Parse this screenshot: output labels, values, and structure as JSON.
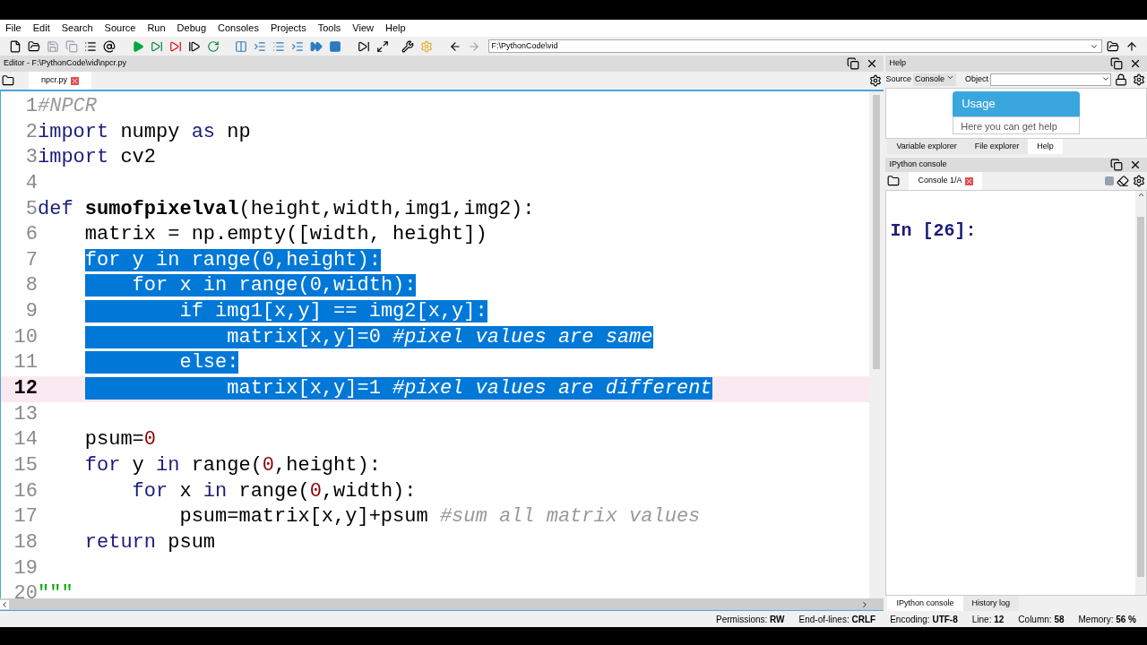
{
  "menu": [
    "File",
    "Edit",
    "Search",
    "Source",
    "Run",
    "Debug",
    "Consoles",
    "Projects",
    "Tools",
    "View",
    "Help"
  ],
  "path_field": {
    "value": "F:\\PythonCode\\vid"
  },
  "editor": {
    "title": "Editor - F:\\PythonCode\\vid\\npcr.py",
    "tabs": [
      {
        "label": "npcr.py",
        "selected": true
      }
    ],
    "lines": [
      {
        "number": "1",
        "selected": false,
        "current": false,
        "tokens": [
          {
            "kind": "comment",
            "text": "#NPCR"
          }
        ]
      },
      {
        "number": "2",
        "selected": false,
        "current": false,
        "tokens": [
          {
            "kind": "keyword",
            "text": "import"
          },
          {
            "kind": "plain",
            "text": " numpy "
          },
          {
            "kind": "keyword",
            "text": "as"
          },
          {
            "kind": "plain",
            "text": " np"
          }
        ]
      },
      {
        "number": "3",
        "selected": false,
        "current": false,
        "tokens": [
          {
            "kind": "keyword",
            "text": "import"
          },
          {
            "kind": "plain",
            "text": " cv2"
          }
        ]
      },
      {
        "number": "4",
        "selected": false,
        "current": false
      },
      {
        "number": "5",
        "selected": false,
        "current": false,
        "tokens": [
          {
            "kind": "keyword",
            "text": "def"
          },
          {
            "kind": "defname",
            "text": " sumofpixelval"
          },
          {
            "kind": "plain",
            "text": "(height,width,img1,img2):"
          }
        ]
      },
      {
        "number": "6",
        "selected": false,
        "current": false,
        "tokens": [
          {
            "kind": "plain",
            "text": "    matrix = np.empty([width, height])"
          }
        ]
      },
      {
        "number": "7",
        "selected": true,
        "current": false,
        "tokens": [
          {
            "kind": "keyword",
            "text": "    for"
          },
          {
            "kind": "plain",
            "text": " y "
          },
          {
            "kind": "keyword",
            "text": "in"
          },
          {
            "kind": "plain",
            "text": " range(0,height):"
          }
        ]
      },
      {
        "number": "8",
        "selected": true,
        "current": false,
        "tokens": [
          {
            "kind": "keyword",
            "text": "        for"
          },
          {
            "kind": "plain",
            "text": " x "
          },
          {
            "kind": "keyword",
            "text": "in"
          },
          {
            "kind": "plain",
            "text": " range(0,width):"
          }
        ]
      },
      {
        "number": "9",
        "selected": true,
        "current": false,
        "tokens": [
          {
            "kind": "keyword",
            "text": "            if"
          },
          {
            "kind": "plain",
            "text": " img1[x,y] == img2[x,y]:"
          }
        ]
      },
      {
        "number": "10",
        "selected": true,
        "current": false,
        "tokens": [
          {
            "kind": "plain",
            "text": "                matrix[x,y]=0 "
          },
          {
            "kind": "comment",
            "text": "#pixel values are same"
          }
        ]
      },
      {
        "number": "11",
        "selected": true,
        "current": false,
        "tokens": [
          {
            "kind": "keyword",
            "text": "            else"
          },
          {
            "kind": "plain",
            "text": ":"
          }
        ]
      },
      {
        "number": "12",
        "selected": true,
        "current": true,
        "tokens": [
          {
            "kind": "plain",
            "text": "                matrix[x,y]=1 "
          },
          {
            "kind": "comment",
            "text": "#pixel values are different"
          }
        ]
      },
      {
        "number": "13",
        "selected": false,
        "current": false
      },
      {
        "number": "14",
        "selected": false,
        "current": false,
        "tokens": [
          {
            "kind": "plain",
            "text": "    psum="
          },
          {
            "kind": "number",
            "text": "0"
          }
        ]
      },
      {
        "number": "15",
        "selected": false,
        "current": false,
        "tokens": [
          {
            "kind": "keyword",
            "text": "    for"
          },
          {
            "kind": "plain",
            "text": " y "
          },
          {
            "kind": "keyword",
            "text": "in"
          },
          {
            "kind": "plain",
            "text": " range("
          },
          {
            "kind": "number",
            "text": "0"
          },
          {
            "kind": "plain",
            "text": ",height):"
          }
        ]
      },
      {
        "number": "16",
        "selected": false,
        "current": false,
        "tokens": [
          {
            "kind": "keyword",
            "text": "        for"
          },
          {
            "kind": "plain",
            "text": " x "
          },
          {
            "kind": "keyword",
            "text": "in"
          },
          {
            "kind": "plain",
            "text": " range("
          },
          {
            "kind": "number",
            "text": "0"
          },
          {
            "kind": "plain",
            "text": ",width):"
          }
        ]
      },
      {
        "number": "17",
        "selected": false,
        "current": false,
        "tokens": [
          {
            "kind": "plain",
            "text": "            psum=matrix[x,y]+psum "
          },
          {
            "kind": "comment",
            "text": "#sum all matrix values"
          }
        ]
      },
      {
        "number": "18",
        "selected": false,
        "current": false,
        "tokens": [
          {
            "kind": "keyword",
            "text": "    return"
          },
          {
            "kind": "plain",
            "text": " psum"
          }
        ]
      },
      {
        "number": "19",
        "selected": false,
        "current": false
      },
      {
        "number": "20",
        "selected": false,
        "current": false,
        "tokens": [
          {
            "kind": "string",
            "text": "\"\"\""
          }
        ]
      }
    ]
  },
  "help": {
    "title": "Help",
    "source_label": "Source",
    "source_value": "Console",
    "object_label": "Object",
    "card_title": "Usage",
    "card_text": "Here you can get help",
    "tabs": [
      {
        "label": "Variable explorer",
        "selected": false
      },
      {
        "label": "File explorer",
        "selected": false
      },
      {
        "label": "Help",
        "selected": true
      }
    ]
  },
  "console": {
    "title": "IPython console",
    "tabs": [
      {
        "label": "Console 1/A",
        "selected": true
      }
    ],
    "prompt": "In [26]:",
    "bottom_tabs": [
      {
        "label": "IPython console",
        "selected": true
      },
      {
        "label": "History log",
        "selected": false
      }
    ]
  },
  "status_bar": [
    {
      "label": "Permissions:",
      "value": "RW"
    },
    {
      "label": "End-of-lines:",
      "value": "CRLF"
    },
    {
      "label": "Encoding:",
      "value": "UTF-8"
    },
    {
      "label": "Line:",
      "value": "12"
    },
    {
      "label": "Column:",
      "value": "58"
    },
    {
      "label": "Memory:",
      "value": "56 %"
    }
  ]
}
